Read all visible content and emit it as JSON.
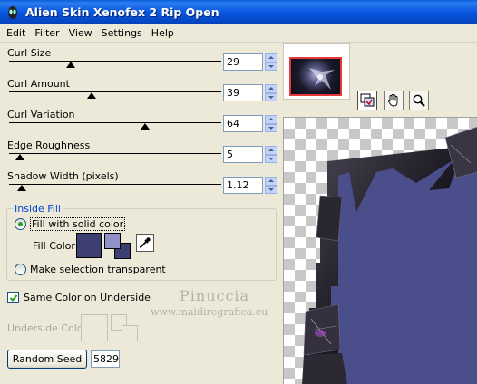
{
  "window": {
    "title": "Alien Skin Xenofex 2 Rip Open",
    "icon": "alien-skin-icon"
  },
  "menu": [
    "Edit",
    "Filter",
    "View",
    "Settings",
    "Help"
  ],
  "params": [
    {
      "label": "Curl Size",
      "value": "29",
      "slider": 0.29
    },
    {
      "label": "Curl Amount",
      "value": "39",
      "slider": 0.39
    },
    {
      "label": "Curl Variation",
      "value": "64",
      "slider": 0.64
    },
    {
      "label": "Edge Roughness",
      "value": "5",
      "slider": 0.05
    },
    {
      "label": "Shadow Width (pixels)",
      "value": "1.12",
      "slider": 0.06
    }
  ],
  "inside_fill": {
    "title": "Inside Fill",
    "option_solid": "Fill with solid color",
    "option_transparent": "Make selection transparent",
    "selected": "solid",
    "fill_color_label": "Fill Color",
    "fill_color": "#3d3f72",
    "swatch_light": "#8f91c7"
  },
  "same_color": {
    "label": "Same Color on Underside",
    "checked": true
  },
  "underside": {
    "label": "Underside Color",
    "enabled": false
  },
  "watermark": {
    "name": "Pinuccia",
    "url": "www.maidiregrafica.eu"
  },
  "random_seed": {
    "label": "Random Seed",
    "value": "5829"
  },
  "tools": [
    "preview-toggle-icon",
    "hand-icon",
    "zoom-icon"
  ],
  "colors": {
    "titlebar": "#0857e0",
    "panel": "#ece9d8",
    "accent": "#0046d5"
  }
}
